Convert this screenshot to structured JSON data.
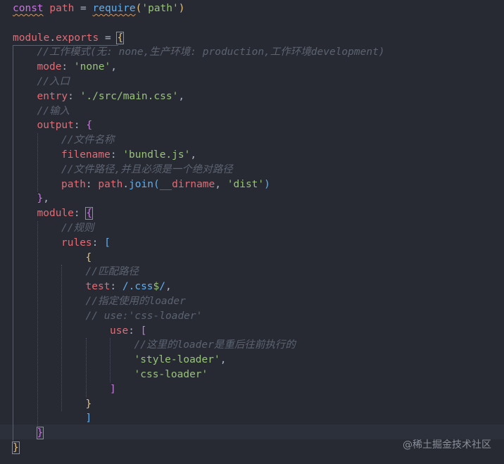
{
  "editor": {
    "language": "javascript",
    "lines": [
      {
        "indent": 0,
        "tokens": [
          {
            "t": "const",
            "c": "kw squiggle"
          },
          {
            "t": " ",
            "c": "punc"
          },
          {
            "t": "path",
            "c": "var"
          },
          {
            "t": " = ",
            "c": "punc"
          },
          {
            "t": "require",
            "c": "fn squiggle"
          },
          {
            "t": "(",
            "c": "brace-1"
          },
          {
            "t": "'path'",
            "c": "str"
          },
          {
            "t": ")",
            "c": "brace-1"
          }
        ]
      },
      {
        "indent": 0,
        "tokens": []
      },
      {
        "indent": 0,
        "tokens": [
          {
            "t": "module",
            "c": "var"
          },
          {
            "t": ".",
            "c": "punc"
          },
          {
            "t": "exports",
            "c": "var"
          },
          {
            "t": " = ",
            "c": "punc"
          },
          {
            "t": "{",
            "c": "brace-1 brace-h"
          }
        ]
      },
      {
        "indent": 1,
        "tokens": [
          {
            "t": "//工作模式(无: none,生产环境: production,工作环境development)",
            "c": "cmt"
          }
        ]
      },
      {
        "indent": 1,
        "tokens": [
          {
            "t": "mode",
            "c": "var"
          },
          {
            "t": ": ",
            "c": "punc"
          },
          {
            "t": "'none'",
            "c": "str"
          },
          {
            "t": ",",
            "c": "punc"
          }
        ]
      },
      {
        "indent": 1,
        "tokens": [
          {
            "t": "//入口",
            "c": "cmt"
          }
        ]
      },
      {
        "indent": 1,
        "tokens": [
          {
            "t": "entry",
            "c": "var"
          },
          {
            "t": ": ",
            "c": "punc"
          },
          {
            "t": "'./src/main.css'",
            "c": "str"
          },
          {
            "t": ",",
            "c": "punc"
          }
        ]
      },
      {
        "indent": 1,
        "tokens": [
          {
            "t": "//输入",
            "c": "cmt"
          }
        ]
      },
      {
        "indent": 1,
        "tokens": [
          {
            "t": "output",
            "c": "var"
          },
          {
            "t": ": ",
            "c": "punc"
          },
          {
            "t": "{",
            "c": "brace-2"
          }
        ]
      },
      {
        "indent": 2,
        "tokens": [
          {
            "t": "//文件名称",
            "c": "cmt"
          }
        ]
      },
      {
        "indent": 2,
        "tokens": [
          {
            "t": "filename",
            "c": "var"
          },
          {
            "t": ": ",
            "c": "punc"
          },
          {
            "t": "'bundle.js'",
            "c": "str"
          },
          {
            "t": ",",
            "c": "punc"
          }
        ]
      },
      {
        "indent": 2,
        "tokens": [
          {
            "t": "//文件路径,并且必须是一个绝对路径",
            "c": "cmt"
          }
        ]
      },
      {
        "indent": 2,
        "tokens": [
          {
            "t": "path",
            "c": "var"
          },
          {
            "t": ": ",
            "c": "punc"
          },
          {
            "t": "path",
            "c": "var"
          },
          {
            "t": ".",
            "c": "punc"
          },
          {
            "t": "join",
            "c": "fn"
          },
          {
            "t": "(",
            "c": "brace-3"
          },
          {
            "t": "__dirname",
            "c": "var"
          },
          {
            "t": ", ",
            "c": "punc"
          },
          {
            "t": "'dist'",
            "c": "str"
          },
          {
            "t": ")",
            "c": "brace-3"
          }
        ]
      },
      {
        "indent": 1,
        "tokens": [
          {
            "t": "}",
            "c": "brace-2"
          },
          {
            "t": ",",
            "c": "punc"
          }
        ]
      },
      {
        "indent": 1,
        "tokens": [
          {
            "t": "module",
            "c": "var"
          },
          {
            "t": ": ",
            "c": "punc"
          },
          {
            "t": "{",
            "c": "brace-2 brace-h"
          }
        ]
      },
      {
        "indent": 2,
        "tokens": [
          {
            "t": "//规则",
            "c": "cmt"
          }
        ]
      },
      {
        "indent": 2,
        "tokens": [
          {
            "t": "rules",
            "c": "var"
          },
          {
            "t": ": ",
            "c": "punc"
          },
          {
            "t": "[",
            "c": "brace-3"
          }
        ]
      },
      {
        "indent": 3,
        "tokens": [
          {
            "t": "{",
            "c": "brace-1"
          }
        ]
      },
      {
        "indent": 3,
        "tokens": [
          {
            "t": "//匹配路径",
            "c": "cmt"
          }
        ]
      },
      {
        "indent": 3,
        "tokens": [
          {
            "t": "test",
            "c": "var"
          },
          {
            "t": ": ",
            "c": "punc"
          },
          {
            "t": "/.css",
            "c": "fn"
          },
          {
            "t": "$",
            "c": "str"
          },
          {
            "t": "/",
            "c": "fn"
          },
          {
            "t": ",",
            "c": "punc"
          }
        ]
      },
      {
        "indent": 3,
        "tokens": [
          {
            "t": "//指定使用的loader",
            "c": "cmt"
          }
        ]
      },
      {
        "indent": 3,
        "tokens": [
          {
            "t": "// use:'css-loader'",
            "c": "cmt"
          }
        ]
      },
      {
        "indent": 4,
        "tokens": [
          {
            "t": "use",
            "c": "var"
          },
          {
            "t": ": ",
            "c": "punc"
          },
          {
            "t": "[",
            "c": "brace-2"
          }
        ]
      },
      {
        "indent": 5,
        "tokens": [
          {
            "t": "//这里的loader是重后往前执行的",
            "c": "cmt"
          }
        ]
      },
      {
        "indent": 5,
        "tokens": [
          {
            "t": "'style-loader'",
            "c": "str"
          },
          {
            "t": ",",
            "c": "punc"
          }
        ]
      },
      {
        "indent": 5,
        "tokens": [
          {
            "t": "'css-loader'",
            "c": "str"
          }
        ]
      },
      {
        "indent": 4,
        "tokens": [
          {
            "t": "]",
            "c": "brace-2"
          }
        ]
      },
      {
        "indent": 3,
        "tokens": [
          {
            "t": "}",
            "c": "brace-1"
          }
        ]
      },
      {
        "indent": 3,
        "tokens": [
          {
            "t": "]",
            "c": "brace-3"
          }
        ]
      },
      {
        "indent": 1,
        "tokens": [
          {
            "t": "}",
            "c": "brace-2 brace-h"
          }
        ]
      },
      {
        "indent": 0,
        "tokens": [
          {
            "t": "}",
            "c": "brace-1 brace-h"
          }
        ]
      }
    ]
  },
  "watermark": "@稀土掘金技术社区",
  "colors": {
    "background": "#272a33",
    "keyword": "#c678dd",
    "variable": "#e06c75",
    "function": "#61afef",
    "string": "#98c379",
    "comment": "#5c6370",
    "bracket_gold": "#e5c07b"
  }
}
